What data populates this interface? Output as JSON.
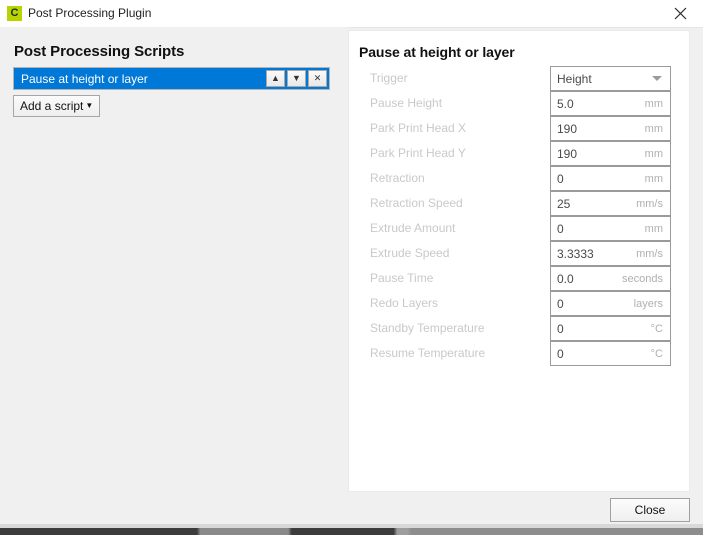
{
  "window": {
    "title": "Post Processing Plugin",
    "app_icon": "cura-logo-icon",
    "app_icon_letter": "C",
    "app_icon_color": "#b8d300",
    "close_icon": "close-icon"
  },
  "left_panel": {
    "heading": "Post Processing Scripts",
    "selected_color": "#0078d7",
    "scripts": [
      {
        "label": "Pause at height or layer",
        "selected": true
      }
    ],
    "list_controls": [
      {
        "name": "move-script-up-button",
        "glyph": "▲"
      },
      {
        "name": "move-script-down-button",
        "glyph": "▼"
      },
      {
        "name": "remove-script-button",
        "glyph": "✕"
      }
    ],
    "add_script_button": {
      "label": "Add a script",
      "caret": "▼"
    }
  },
  "settings_panel": {
    "title": "Pause at height or layer",
    "rows": [
      {
        "label": "Trigger",
        "value": "Height",
        "unit": "",
        "type": "combo"
      },
      {
        "label": "Pause Height",
        "value": "5.0",
        "unit": "mm",
        "type": "text"
      },
      {
        "label": "Park Print Head X",
        "value": "190",
        "unit": "mm",
        "type": "text"
      },
      {
        "label": "Park Print Head Y",
        "value": "190",
        "unit": "mm",
        "type": "text"
      },
      {
        "label": "Retraction",
        "value": "0",
        "unit": "mm",
        "type": "text"
      },
      {
        "label": "Retraction Speed",
        "value": "25",
        "unit": "mm/s",
        "type": "text"
      },
      {
        "label": "Extrude Amount",
        "value": "0",
        "unit": "mm",
        "type": "text"
      },
      {
        "label": "Extrude Speed",
        "value": "3.3333",
        "unit": "mm/s",
        "type": "text"
      },
      {
        "label": "Pause Time",
        "value": "0.0",
        "unit": "seconds",
        "type": "text"
      },
      {
        "label": "Redo Layers",
        "value": "0",
        "unit": "layers",
        "type": "text"
      },
      {
        "label": "Standby Temperature",
        "value": "0",
        "unit": "°C",
        "type": "text"
      },
      {
        "label": "Resume Temperature",
        "value": "0",
        "unit": "°C",
        "type": "text"
      }
    ]
  },
  "footer": {
    "close_label": "Close"
  }
}
